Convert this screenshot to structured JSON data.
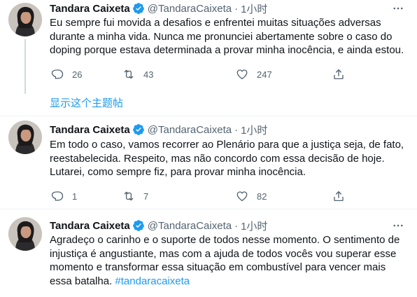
{
  "colors": {
    "accent": "#1d9bf0",
    "text": "#0f1419",
    "muted": "#536471",
    "divider": "#eff3f4",
    "verified": "#1d9bf0"
  },
  "show_thread_label": "显示这个主题帖",
  "tweets": [
    {
      "author": {
        "name": "Tandara Caixeta",
        "handle": "@TandaraCaixeta",
        "verified": true
      },
      "separator": "·",
      "time": "1小时",
      "text_lines": [
        "Eu sempre fui movida a desafios e enfrentei muitas situações adversas",
        "durante a minha vida. Nunca me pronunciei abertamente sobre o caso do",
        "doping porque estava determinada a provar minha inocência, e ainda estou."
      ],
      "hashtag": "",
      "replies": "26",
      "retweets": "43",
      "likes": "247"
    },
    {
      "author": {
        "name": "Tandara Caixeta",
        "handle": "@TandaraCaixeta",
        "verified": true
      },
      "separator": "·",
      "time": "1小时",
      "text_lines": [
        "Em todo o caso, vamos recorrer ao Plenário para que a justiça seja, de fato,",
        "reestabelecida. Respeito, mas não concordo com essa decisão de hoje.",
        "Lutarei, como sempre fiz, para provar minha inocência."
      ],
      "hashtag": "",
      "replies": "1",
      "retweets": "7",
      "likes": "82"
    },
    {
      "author": {
        "name": "Tandara Caixeta",
        "handle": "@TandaraCaixeta",
        "verified": true
      },
      "separator": "·",
      "time": "1小时",
      "text_lines": [
        "Agradeço o carinho e o suporte de todos nesse momento. O sentimento de",
        "injustiça é angustiante, mas com a ajuda de todos vocês vou superar esse",
        "momento e transformar essa situação em combustível para vencer mais",
        "essa batalha."
      ],
      "hashtag": "#tandaracaixeta"
    }
  ],
  "icons": {
    "more": "more-horizontal-icon",
    "reply": "reply-icon",
    "retweet": "retweet-icon",
    "like": "heart-icon",
    "share": "share-icon",
    "verified": "verified-badge-icon"
  }
}
